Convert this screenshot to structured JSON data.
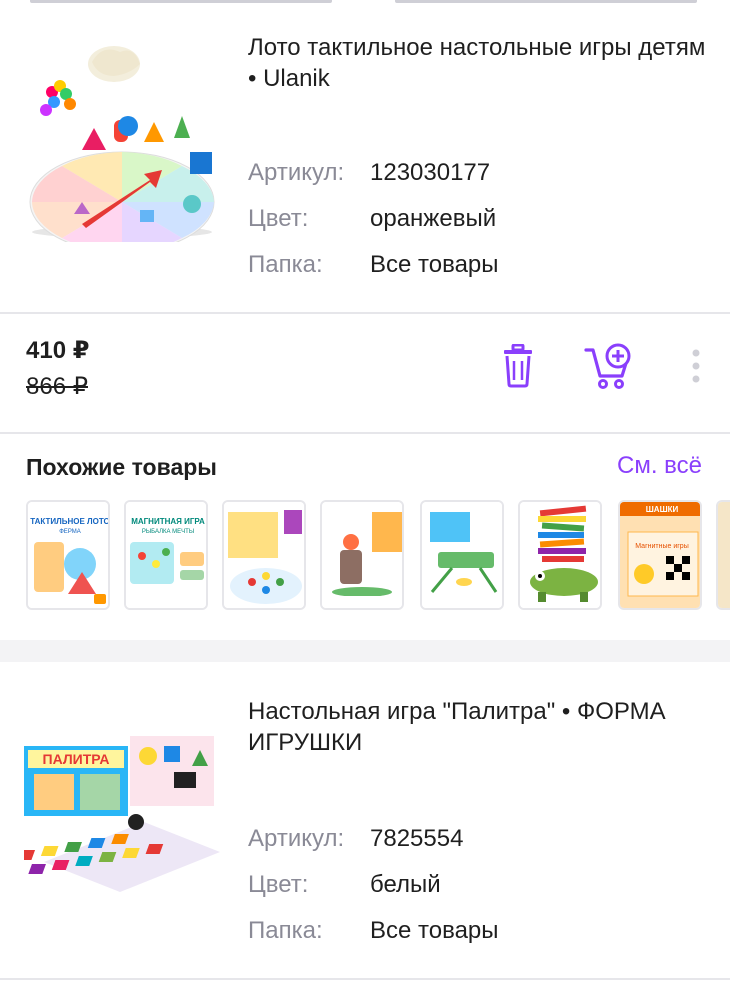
{
  "products": [
    {
      "title": "Лото тактильное настольные игры детям • Ulanik",
      "attributes": [
        {
          "key": "Артикул:",
          "value": "123030177"
        },
        {
          "key": "Цвет:",
          "value": "оранжевый"
        },
        {
          "key": "Папка:",
          "value": "Все товары"
        }
      ],
      "price_new": "410 ₽",
      "price_old": "866 ₽"
    },
    {
      "title": "Настольная игра \"Палитра\" • ФОРМА ИГРУШКИ",
      "attributes": [
        {
          "key": "Артикул:",
          "value": "7825554"
        },
        {
          "key": "Цвет:",
          "value": "белый"
        },
        {
          "key": "Папка:",
          "value": "Все товары"
        }
      ]
    }
  ],
  "similar": {
    "title": "Похожие товары",
    "see_all": "См. всё",
    "thumbs": [
      {
        "line1": "ТАКТИЛЬНОЕ ЛОТО",
        "line2": "ФЕРМА"
      },
      {
        "line1": "МАГНИТНАЯ ИГРА",
        "line2": "РЫБАЛКА МЕЧТЫ"
      },
      {
        "line1": "",
        "line2": ""
      },
      {
        "line1": "",
        "line2": ""
      },
      {
        "line1": "",
        "line2": ""
      },
      {
        "line1": "",
        "line2": ""
      },
      {
        "line1": "ШАШКИ",
        "line2": "Магнитные игры"
      }
    ]
  },
  "icons": {
    "delete": "trash-icon",
    "add_to_cart": "cart-plus-icon",
    "more": "more-vertical-icon"
  },
  "colors": {
    "accent": "#8a3ffc",
    "muted_text": "#8a8a96",
    "divider": "#e6e6ea"
  }
}
